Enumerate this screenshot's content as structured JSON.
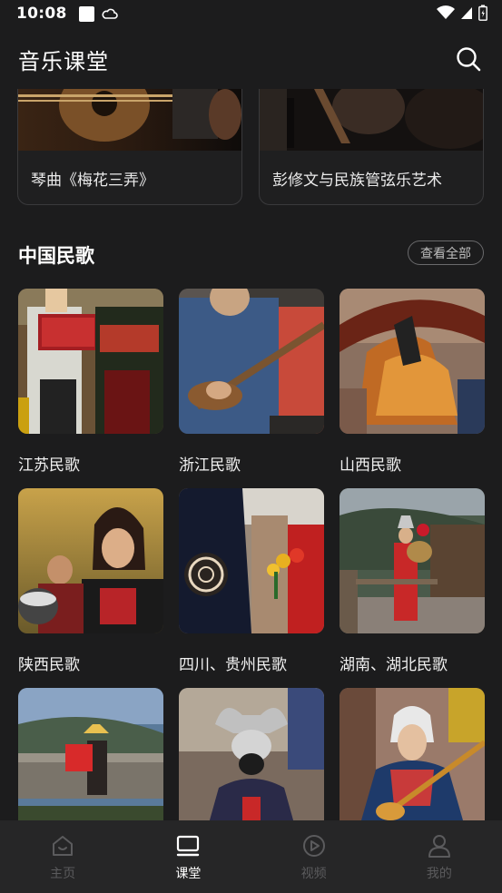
{
  "status": {
    "time": "10:08"
  },
  "header": {
    "title": "音乐课堂",
    "search_icon": "search-icon"
  },
  "featured": [
    {
      "caption": "琴曲《梅花三弄》"
    },
    {
      "caption": "彭修文与民族管弦乐艺术"
    }
  ],
  "section": {
    "title": "中国民歌",
    "view_all": "查看全部"
  },
  "songs": [
    {
      "label": "江苏民歌"
    },
    {
      "label": "浙江民歌"
    },
    {
      "label": "山西民歌"
    },
    {
      "label": "陕西民歌"
    },
    {
      "label": "四川、贵州民歌"
    },
    {
      "label": "湖南、湖北民歌"
    },
    {
      "label": ""
    },
    {
      "label": ""
    },
    {
      "label": ""
    }
  ],
  "nav": [
    {
      "label": "主页",
      "icon": "home-icon",
      "active": false
    },
    {
      "label": "课堂",
      "icon": "classroom-icon",
      "active": true
    },
    {
      "label": "视频",
      "icon": "video-icon",
      "active": false
    },
    {
      "label": "我的",
      "icon": "profile-icon",
      "active": false
    }
  ],
  "colors": {
    "background": "#1c1c1d",
    "nav_background": "#262627",
    "nav_inactive": "#5b5b5d",
    "nav_active": "#ffffff"
  }
}
